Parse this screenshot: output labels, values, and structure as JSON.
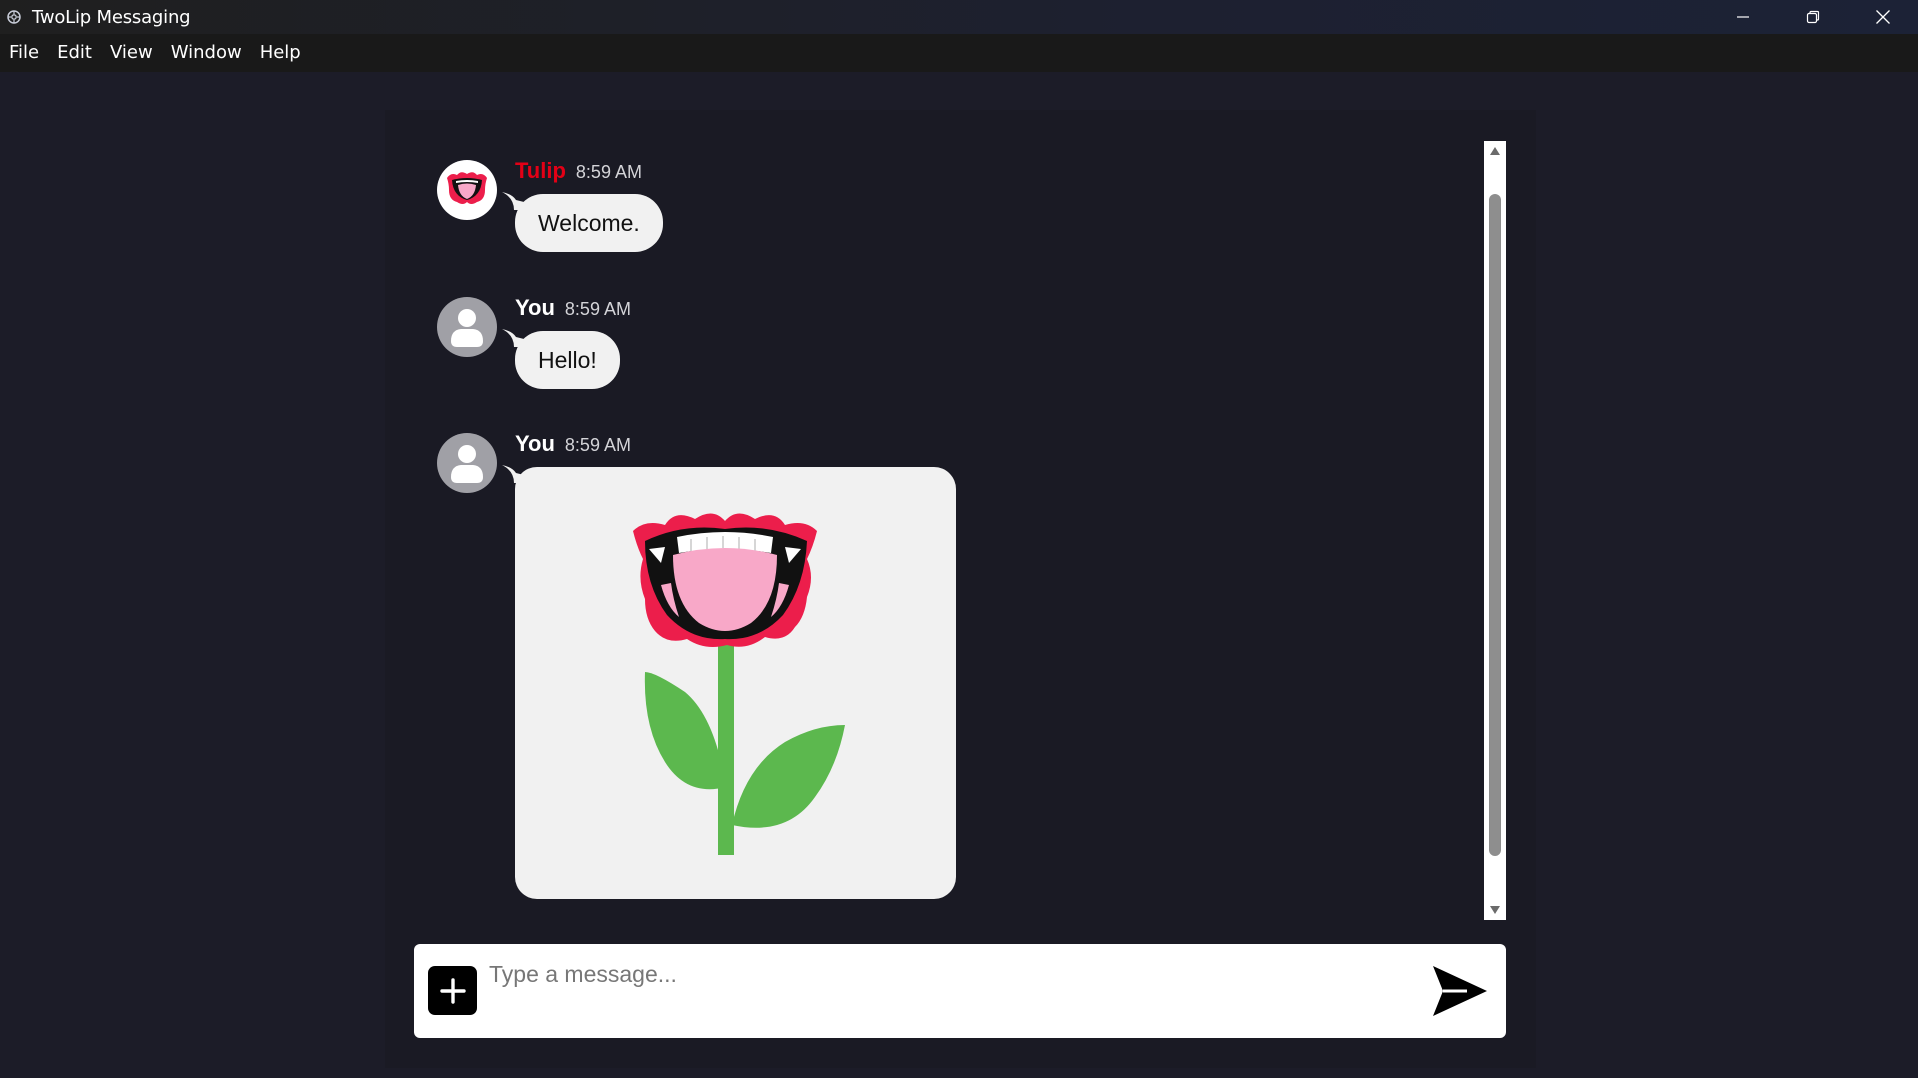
{
  "window": {
    "title": "TwoLip Messaging",
    "controls": [
      "minimize-icon",
      "restore-icon",
      "close-icon"
    ]
  },
  "menu": {
    "items": [
      "File",
      "Edit",
      "View",
      "Window",
      "Help"
    ]
  },
  "messages": [
    {
      "sender": "Tulip",
      "time": "8:59 AM",
      "text": "Welcome.",
      "avatar": "tulip-mouth-icon",
      "sender_color": "#e30016"
    },
    {
      "sender": "You",
      "time": "8:59 AM",
      "text": "Hello!",
      "avatar": "user-icon"
    },
    {
      "sender": "You",
      "time": "8:59 AM",
      "image": "tulip-mouth-flower-image",
      "avatar": "user-icon"
    }
  ],
  "composer": {
    "placeholder": "Type a message...",
    "value": "",
    "add_icon": "plus-icon",
    "send_icon": "send-icon"
  },
  "colors": {
    "background": "#1c1c28",
    "panel": "#1a1a24",
    "bubble": "#f1f1f1",
    "accent_red": "#e30016",
    "leaf_green": "#5cb84e",
    "tongue_pink": "#f8a8c8"
  }
}
